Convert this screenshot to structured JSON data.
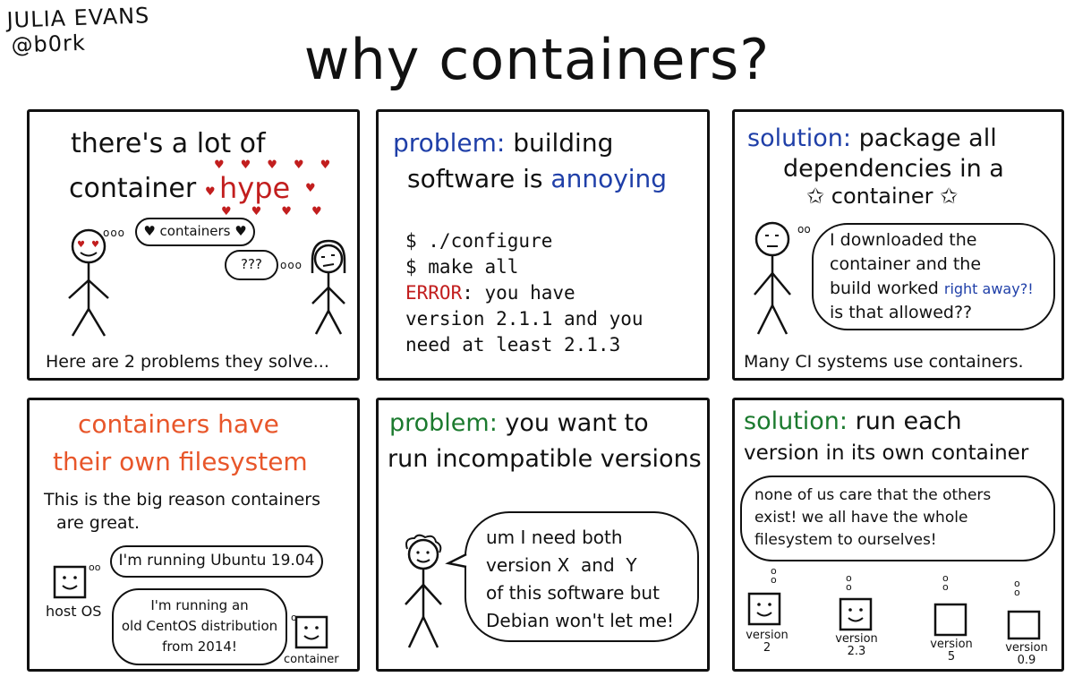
{
  "author": {
    "name": "JULIA EVANS",
    "handle": "@b0rk"
  },
  "title": "why containers?",
  "panel1": {
    "heading_line1": "there's a lot of",
    "heading_line2": "container",
    "heading_hype": "hype",
    "bubble_containers": "♥ containers ♥",
    "bubble_question": "???",
    "footer": "Here are 2 problems they solve..."
  },
  "panel2": {
    "label": "problem:",
    "heading_a": "building",
    "heading_b": "software is",
    "heading_c": "annoying",
    "terminal": {
      "line1": "$ ./configure",
      "line2": "$ make all",
      "error_word": "ERROR",
      "line3_rest": ": you have",
      "line4": "version 2.1.1 and you",
      "line5": "need at least 2.1.3"
    }
  },
  "panel3": {
    "label": "solution:",
    "heading_a": "package all",
    "heading_b": "dependencies in a",
    "heading_c": "container",
    "bubble_line1": "I downloaded the",
    "bubble_line2": "container and the",
    "bubble_line3a": "build worked",
    "bubble_line3b": "right away?!",
    "bubble_line4": "is that allowed??",
    "footer": "Many CI systems use containers."
  },
  "panel4": {
    "heading_line1": "containers have",
    "heading_line2": "their own filesystem",
    "body_line1": "This is the big reason containers",
    "body_line2": "are great.",
    "bubble_host": "I'm running Ubuntu 19.04",
    "bubble_container_1": "I'm running an",
    "bubble_container_2": "old CentOS distribution",
    "bubble_container_3": "from 2014!",
    "label_host": "host OS",
    "label_container": "container"
  },
  "panel5": {
    "label": "problem:",
    "heading_a": "you want to",
    "heading_b": "run incompatible versions",
    "bubble_line1": "um I need both",
    "bubble_line2": "version X  and  Y",
    "bubble_line3": "of this software but",
    "bubble_line4": "Debian won't let me!"
  },
  "panel6": {
    "label": "solution:",
    "heading_a": "run each",
    "heading_b": "version in its own container",
    "bubble_line1": "none of us care that the others",
    "bubble_line2": "exist! we all have the whole",
    "bubble_line3": "filesystem to ourselves!",
    "versions": [
      {
        "label": "version",
        "num": "2"
      },
      {
        "label": "version",
        "num": "2.3"
      },
      {
        "label": "version",
        "num": "5"
      },
      {
        "label": "version",
        "num": "0.9"
      }
    ]
  },
  "colors": {
    "blue": "#1f3fa8",
    "red": "#c21e1e",
    "orange": "#e8562a",
    "green": "#1b7a2e",
    "ink": "#111111"
  }
}
